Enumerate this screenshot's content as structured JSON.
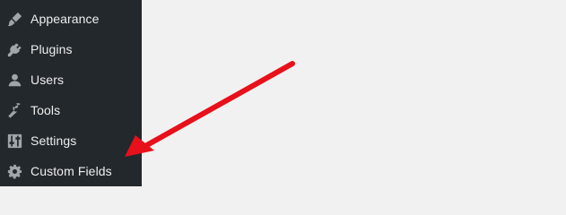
{
  "sidebar": {
    "items": [
      {
        "label": "Appearance",
        "icon": "paintbrush-icon"
      },
      {
        "label": "Plugins",
        "icon": "plug-icon"
      },
      {
        "label": "Users",
        "icon": "user-icon"
      },
      {
        "label": "Tools",
        "icon": "wrench-icon"
      },
      {
        "label": "Settings",
        "icon": "settings-sliders-icon"
      },
      {
        "label": "Custom Fields",
        "icon": "gear-icon"
      }
    ]
  },
  "colors": {
    "sidebar_bg": "#23282d",
    "menu_text": "#eeeeee",
    "menu_icon": "#a0a5aa",
    "content_bg": "#f1f1f1",
    "annotation_arrow": "#e8101a"
  }
}
